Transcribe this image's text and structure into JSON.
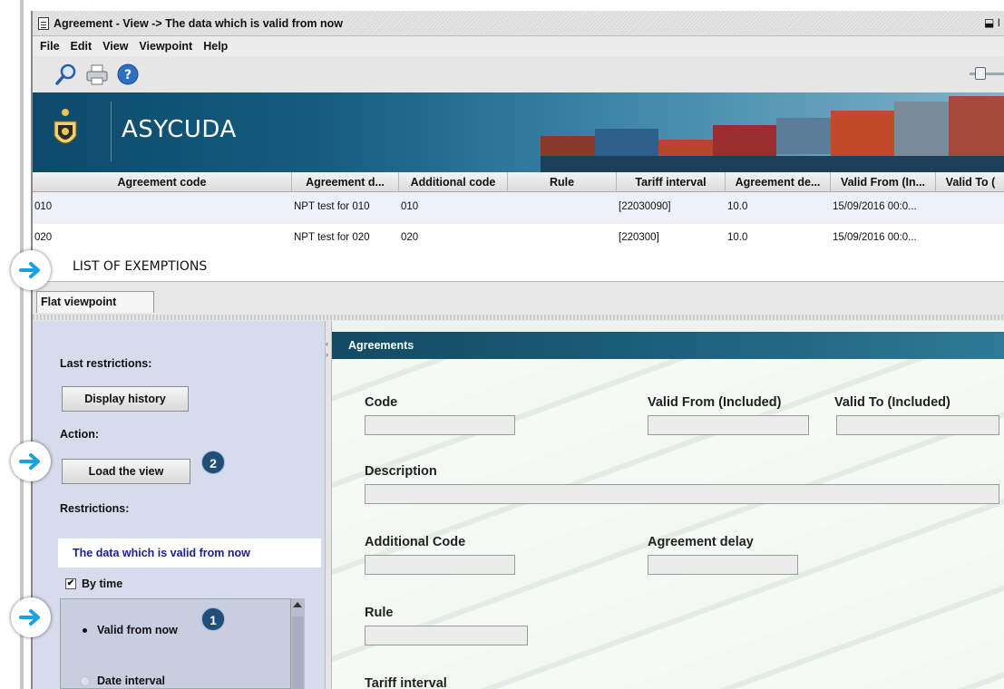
{
  "window": {
    "title": "Agreement - View  -> The data which is valid from now",
    "restore_glyph": "⬓ I"
  },
  "menu": [
    "File",
    "Edit",
    "View",
    "Viewpoint",
    "Help"
  ],
  "toolbar_icons": [
    "search-icon",
    "print-icon",
    "help-icon"
  ],
  "banner": {
    "brand": "ASYCUDA"
  },
  "table": {
    "columns": [
      "Agreement code",
      "Agreement d...",
      "Additional code",
      "Rule",
      "Tariff interval",
      "Agreement de...",
      "Valid From (In...",
      "Valid To ("
    ],
    "rows": [
      [
        "010",
        "NPT test for 010",
        "010",
        "",
        "[22030090]",
        "10.0",
        "15/09/2016 00:0...",
        ""
      ],
      [
        "020",
        "NPT test for 020",
        "020",
        "",
        "[220300]",
        "10.0",
        "15/09/2016 00:0...",
        ""
      ]
    ]
  },
  "annotation": {
    "list_label": "LIST OF EXEMPTIONS",
    "badge_1": "1",
    "badge_2": "2"
  },
  "tabs": {
    "flat": "Flat viewpoint"
  },
  "left_panel": {
    "last_restrictions": "Last restrictions:",
    "display_history": "Display history",
    "action": "Action:",
    "load_view": "Load the view",
    "restrictions": "Restrictions:",
    "restriction_text": "The data which is valid from now",
    "by_time": "By time",
    "by_time_checked": true,
    "valid_from_now": "Valid from now",
    "date_interval": "Date interval"
  },
  "right_panel": {
    "header": "Agreements",
    "labels": {
      "code": "Code",
      "valid_from": "Valid From (Included)",
      "valid_to": "Valid To (Included)",
      "description": "Description",
      "additional_code": "Additional Code",
      "agreement_delay": "Agreement delay",
      "rule": "Rule",
      "tariff_interval": "Tariff interval"
    }
  },
  "colors": {
    "accent_blue": "#1f4e79",
    "banner": "#155c80",
    "arrow": "#1ea0e0"
  }
}
